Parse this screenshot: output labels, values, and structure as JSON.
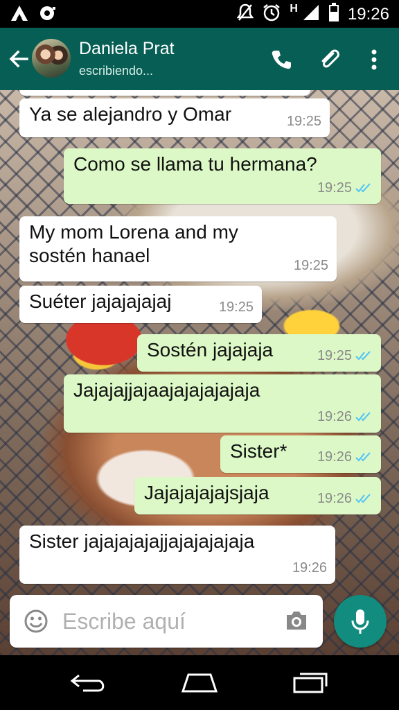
{
  "status_bar": {
    "time": "19:26",
    "network_label": "H",
    "icons": [
      "notification-a-icon",
      "record-icon",
      "mute-icon",
      "alarm-icon",
      "signal-icon",
      "battery-icon"
    ]
  },
  "header": {
    "contact_name": "Daniela Prat",
    "contact_status": "escribiendo...",
    "icons": [
      "back-arrow-icon",
      "phone-icon",
      "attach-icon",
      "more-vert-icon"
    ],
    "color": "#075e54"
  },
  "messages": [
    {
      "direction": "in",
      "text": "Ya se alejandro y Omar",
      "time": "19:25"
    },
    {
      "direction": "out",
      "text": "Como se llama tu hermana?",
      "time": "19:25",
      "ticks": "read"
    },
    {
      "direction": "in",
      "text": "My mom Lorena and my sostén hanael",
      "time": "19:25"
    },
    {
      "direction": "in",
      "text": "Suéter jajajajajaj",
      "time": "19:25"
    },
    {
      "direction": "out",
      "text": "Sostén jajajaja",
      "time": "19:25",
      "ticks": "read"
    },
    {
      "direction": "out",
      "text": "Jajajajjajaajajajajajaja",
      "time": "19:26",
      "ticks": "read"
    },
    {
      "direction": "out",
      "text": "Sister*",
      "time": "19:26",
      "ticks": "read"
    },
    {
      "direction": "out",
      "text": "Jajajajajajsjaja",
      "time": "19:26",
      "ticks": "read"
    },
    {
      "direction": "in",
      "text": "Sister jajajajajajjajajajajaja",
      "time": "19:26"
    }
  ],
  "input": {
    "placeholder": "Escribe aquí",
    "value": ""
  },
  "colors": {
    "incoming_bubble": "#ffffff",
    "outgoing_bubble": "#dcf8c6",
    "read_ticks": "#4fc3f7",
    "mic_button": "#128c7e"
  },
  "nav_bar": {
    "icons": [
      "back-nav-icon",
      "home-nav-icon",
      "recents-nav-icon"
    ]
  }
}
